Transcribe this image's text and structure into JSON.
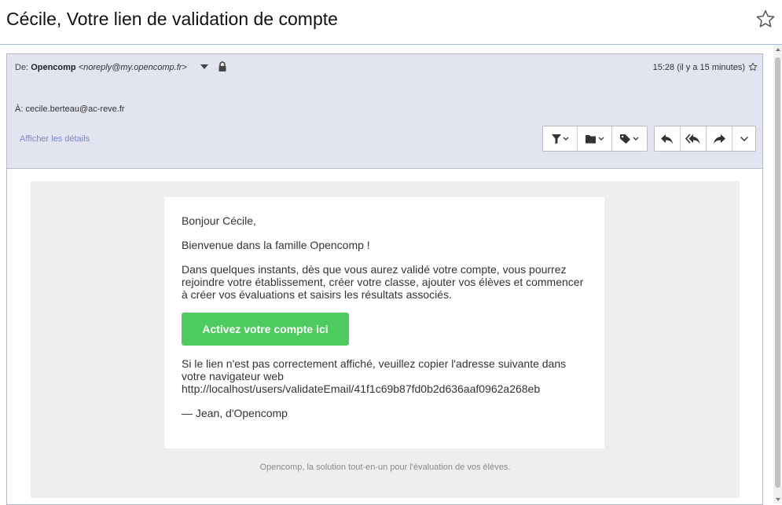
{
  "subject": "Cécile, Votre lien de validation de compte",
  "header": {
    "from_label": "De:",
    "from_name": "Opencomp",
    "from_address": "<noreply@my.opencomp.fr>",
    "time": "15:28 (il y a 15 minutes)",
    "to_label": "À:",
    "to_address": "cecile.berteau@ac-reve.fr",
    "details_link": "Afficher les détails"
  },
  "toolbar": {
    "group1": [
      "filter-icon",
      "folder-icon",
      "tag-icon"
    ],
    "group2": [
      "reply-icon",
      "reply-all-icon",
      "forward-icon",
      "more-icon"
    ]
  },
  "email": {
    "greeting": "Bonjour Cécile,",
    "welcome": "Bienvenue dans la famille Opencomp !",
    "intro": "Dans quelques instants, dès que vous aurez validé votre compte, vous pourrez rejoindre votre établissement, créer votre classe, ajouter vos élèves et commencer à créer vos évaluations et saisirs les résultats associés.",
    "cta_label": "Activez votre compte ici",
    "fallback_text": "Si le lien n'est pas correctement affiché, veuillez copier l'adresse suivante dans votre navigateur web",
    "fallback_url": "http://localhost/users/validateEmail/41f1c69b87fd0b2d636aaf0962a268eb",
    "signature": "— Jean, d'Opencomp",
    "footer": "Opencomp, la solution tout-en-un pour l'évaluation de vos élèves."
  },
  "colors": {
    "header_bg": "#e2e4ef",
    "cta_bg": "#4dcb5e",
    "link": "#7b86c9"
  }
}
